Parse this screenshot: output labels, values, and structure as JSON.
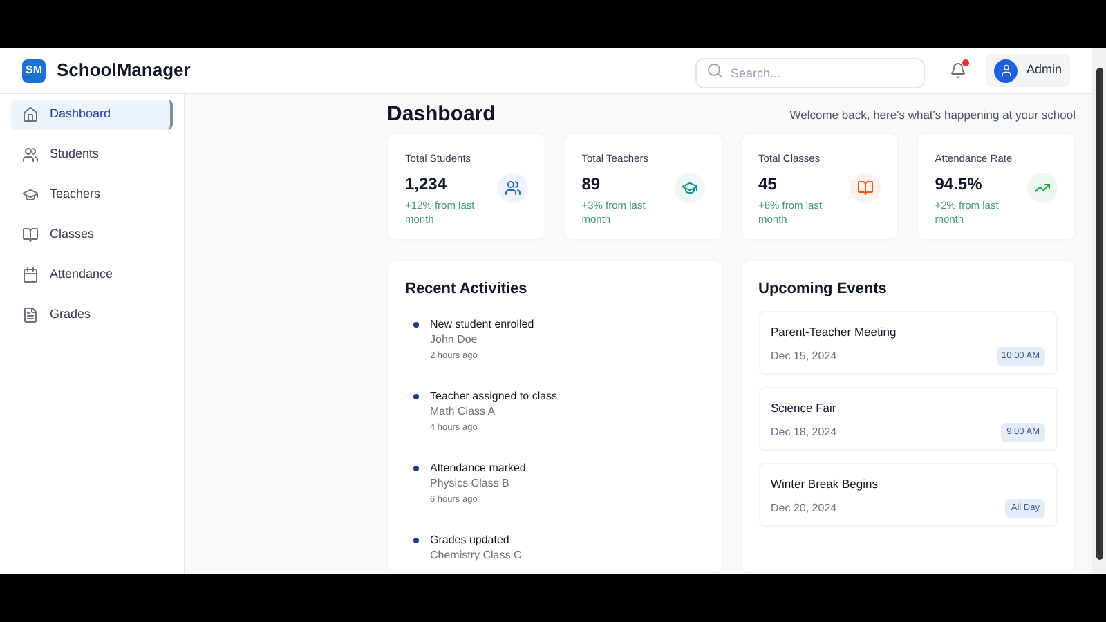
{
  "brand": {
    "logo": "SM",
    "name": "SchoolManager"
  },
  "search": {
    "placeholder": "Search..."
  },
  "notifications": {
    "unread": true
  },
  "user": {
    "name": "Admin"
  },
  "sidebar": {
    "items": [
      {
        "label": "Dashboard",
        "kind": "home",
        "selected": true
      },
      {
        "label": "Students",
        "kind": "users",
        "selected": false
      },
      {
        "label": "Teachers",
        "kind": "cap",
        "selected": false
      },
      {
        "label": "Classes",
        "kind": "book",
        "selected": false
      },
      {
        "label": "Attendance",
        "kind": "calendar",
        "selected": false
      },
      {
        "label": "Grades",
        "kind": "file",
        "selected": false
      }
    ]
  },
  "page": {
    "title": "Dashboard",
    "subtitle": "Welcome back, here's what's happening at your school"
  },
  "stats": [
    {
      "label": "Total Students",
      "value": "1,234",
      "change": "+12% from last month",
      "kind": "users",
      "color": "#2563eb"
    },
    {
      "label": "Total Teachers",
      "value": "89",
      "change": "+3% from last month",
      "kind": "cap",
      "color": "#0d9488"
    },
    {
      "label": "Total Classes",
      "value": "45",
      "change": "+8% from last month",
      "kind": "book",
      "color": "#ea580c"
    },
    {
      "label": "Attendance Rate",
      "value": "94.5%",
      "change": "+2% from last month",
      "kind": "trend",
      "color": "#16a34a"
    }
  ],
  "recent_activities": {
    "title": "Recent Activities",
    "items": [
      {
        "title": "New student enrolled",
        "detail": "John Doe",
        "time": "2 hours ago"
      },
      {
        "title": "Teacher assigned to class",
        "detail": "Math Class A",
        "time": "4 hours ago"
      },
      {
        "title": "Attendance marked",
        "detail": "Physics Class B",
        "time": "6 hours ago"
      },
      {
        "title": "Grades updated",
        "detail": "Chemistry Class C"
      }
    ]
  },
  "upcoming_events": {
    "title": "Upcoming Events",
    "items": [
      {
        "title": "Parent-Teacher Meeting",
        "date": "Dec 15, 2024",
        "time": "10:00 AM"
      },
      {
        "title": "Science Fair",
        "date": "Dec 18, 2024",
        "time": "9:00 AM"
      },
      {
        "title": "Winter Break Begins",
        "date": "Dec 20, 2024",
        "time": "All Day"
      }
    ]
  }
}
